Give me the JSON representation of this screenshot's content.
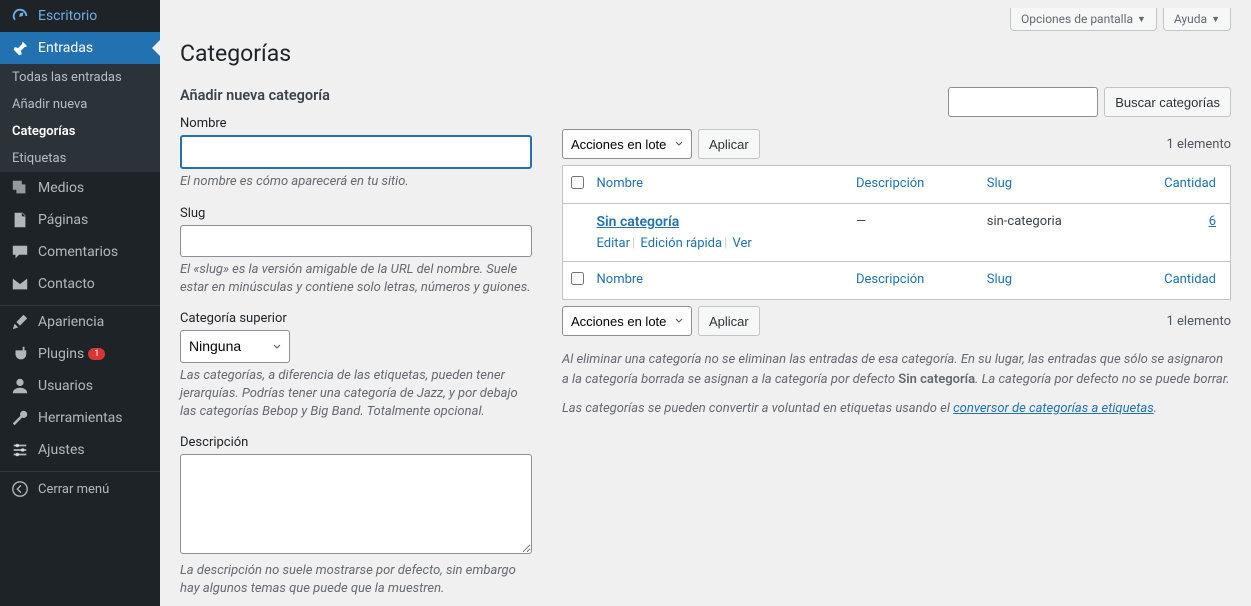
{
  "sidebar": {
    "dashboard": "Escritorio",
    "posts": "Entradas",
    "posts_sub": [
      "Todas las entradas",
      "Añadir nueva",
      "Categorías",
      "Etiquetas"
    ],
    "media": "Medios",
    "pages": "Páginas",
    "comments": "Comentarios",
    "contact": "Contacto",
    "appearance": "Apariencia",
    "plugins": "Plugins",
    "plugins_badge": "1",
    "users": "Usuarios",
    "tools": "Herramientas",
    "settings": "Ajustes",
    "collapse": "Cerrar menú"
  },
  "topbar": {
    "screen_options": "Opciones de pantalla",
    "help": "Ayuda"
  },
  "page": {
    "title": "Categorías"
  },
  "form": {
    "heading": "Añadir nueva categoría",
    "name_label": "Nombre",
    "name_help": "El nombre es cómo aparecerá en tu sitio.",
    "slug_label": "Slug",
    "slug_help": "El «slug» es la versión amigable de la URL del nombre. Suele estar en minúsculas y contiene solo letras, números y guiones.",
    "parent_label": "Categoría superior",
    "parent_option": "Ninguna",
    "parent_help": "Las categorías, a diferencia de las etiquetas, pueden tener jerarquías. Podrías tener una categoría de Jazz, y por debajo las categorías Bebop y Big Band. Totalmente opcional.",
    "desc_label": "Descripción",
    "desc_help": "La descripción no suele mostrarse por defecto, sin embargo hay algunos temas que puede que la muestren."
  },
  "search": {
    "button": "Buscar categorías"
  },
  "bulk": {
    "label": "Acciones en lote",
    "apply": "Aplicar"
  },
  "count_text": "1 elemento",
  "table": {
    "col_name": "Nombre",
    "col_desc": "Descripción",
    "col_slug": "Slug",
    "col_count": "Cantidad",
    "row": {
      "name": "Sin categoría",
      "desc": "—",
      "slug": "sin-categoria",
      "count": "6",
      "actions": {
        "edit": "Editar",
        "quick": "Edición rápida",
        "view": "Ver"
      }
    }
  },
  "notes": {
    "p1a": "Al eliminar una categoría no se eliminan las entradas de esa categoría. En su lugar, las entradas que sólo se asignaron a la categoría borrada se asignan a la categoría por defecto ",
    "p1b": "Sin categoría",
    "p1c": ". La categoría por defecto no se puede borrar.",
    "p2a": "Las categorías se pueden convertir a voluntad en etiquetas usando el ",
    "p2b": "conversor de categorías a etiquetas",
    "p2c": "."
  }
}
